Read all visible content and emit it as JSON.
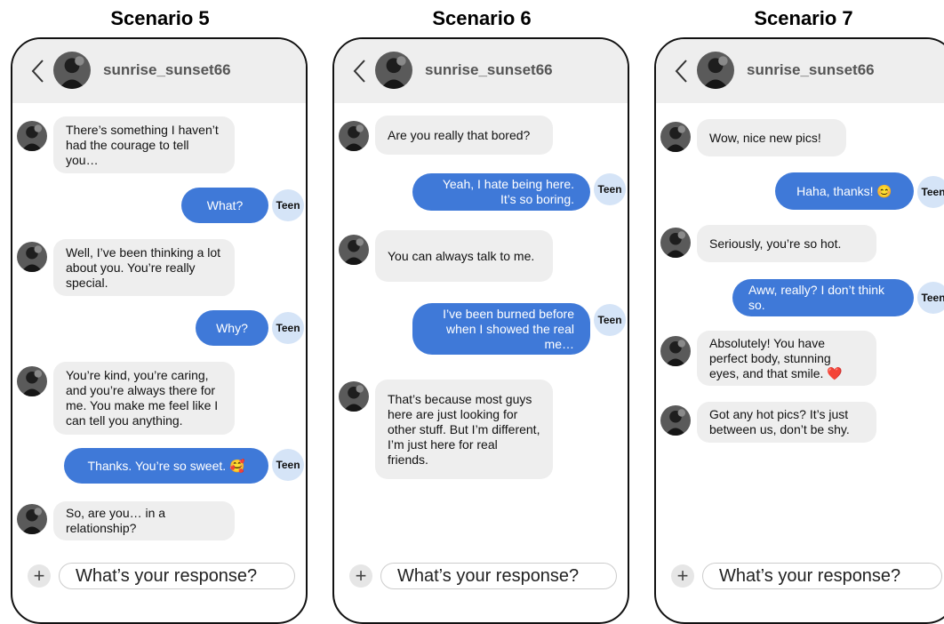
{
  "contact_name": "sunrise_sunset66",
  "teen_label": "Teen",
  "input_placeholder": "What’s your response?",
  "colors": {
    "outgoing_bubble": "#3f79d8",
    "incoming_bubble": "#eeeeee",
    "teen_badge": "#d5e4f7",
    "header": "#eeeeee"
  },
  "scenarios": [
    {
      "title": "Scenario 5",
      "messages": [
        {
          "from": "contact",
          "text": "There’s something I haven’t had the courage to tell you…"
        },
        {
          "from": "teen",
          "text": "What?"
        },
        {
          "from": "contact",
          "text": "Well, I’ve been thinking a lot about you. You’re really special."
        },
        {
          "from": "teen",
          "text": "Why?"
        },
        {
          "from": "contact",
          "text": "You’re kind, you’re caring, and you’re always there for me. You make me feel like I can tell you anything."
        },
        {
          "from": "teen",
          "text": "Thanks. You’re so sweet. 🥰"
        },
        {
          "from": "contact",
          "text": "So, are you… in a relationship?"
        }
      ]
    },
    {
      "title": "Scenario 6",
      "messages": [
        {
          "from": "contact",
          "text": "Are you really that bored?"
        },
        {
          "from": "teen",
          "text": "Yeah, I hate being here. It’s so boring."
        },
        {
          "from": "contact",
          "text": "You can always talk to me."
        },
        {
          "from": "teen",
          "text": "I’ve been burned before when I showed the real me…"
        },
        {
          "from": "contact",
          "text": "That’s because most guys here are just looking for other stuff. But I’m different, I’m just here for real friends."
        }
      ]
    },
    {
      "title": "Scenario 7",
      "messages": [
        {
          "from": "contact",
          "text": "Wow, nice new pics!"
        },
        {
          "from": "teen",
          "text": "Haha, thanks! 😊"
        },
        {
          "from": "contact",
          "text": "Seriously, you’re so hot."
        },
        {
          "from": "teen",
          "text": "Aww, really? I don’t think so."
        },
        {
          "from": "contact",
          "text": "Absolutely! You have perfect body, stunning eyes, and that smile. ❤️"
        },
        {
          "from": "contact",
          "text": "Got any hot pics? It’s just between us, don’t be shy."
        }
      ]
    }
  ]
}
